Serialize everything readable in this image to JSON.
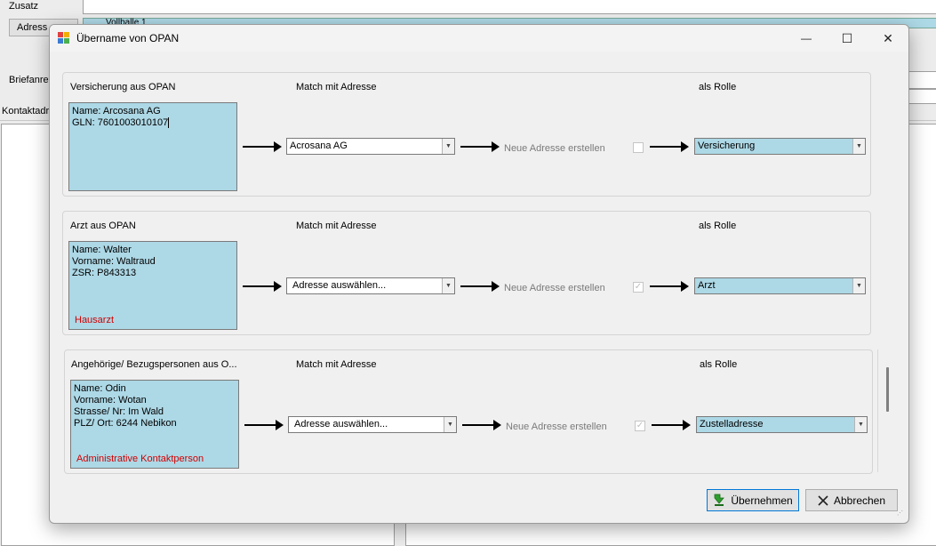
{
  "background": {
    "zusatz_label": "Zusatz",
    "adresse_button": "Adress",
    "tab_text": "Vollballe 1",
    "briefanrede_label": "Briefanrec",
    "kontaktadresse_label": "Kontaktadr"
  },
  "dialog": {
    "title": "Übername von OPAN",
    "minimize_symbol": "—",
    "maximize_symbol": "☐",
    "close_symbol": "✕",
    "ok_label": "Übernehmen",
    "cancel_label": "Abbrechen",
    "sections": [
      {
        "header": "Versicherung aus OPAN",
        "match_header": "Match mit Adresse",
        "role_header": "als Rolle",
        "info_lines": [
          "Name: Arcosana AG",
          "GLN: 7601003010107"
        ],
        "note": "",
        "match_value": "Acrosana AG",
        "new_address_label": "Neue Adresse erstellen",
        "new_address_checked": false,
        "role_value": "Versicherung"
      },
      {
        "header": "Arzt aus OPAN",
        "match_header": "Match mit Adresse",
        "role_header": "als Rolle",
        "info_lines": [
          "Name: Walter",
          "Vorname: Waltraud",
          "ZSR: P843313"
        ],
        "note": "Hausarzt",
        "match_value": "Adresse auswählen...",
        "new_address_label": "Neue Adresse erstellen",
        "new_address_checked": true,
        "role_value": "Arzt"
      },
      {
        "header": "Angehörige/ Bezugspersonen aus O...",
        "match_header": "Match mit Adresse",
        "role_header": "als Rolle",
        "info_lines": [
          "Name: Odin",
          "Vorname: Wotan",
          "Strasse/ Nr: Im Wald",
          "PLZ/ Ort: 6244 Nebikon"
        ],
        "note": "Administrative Kontaktperson",
        "match_value": "Adresse auswählen...",
        "new_address_label": "Neue Adresse erstellen",
        "new_address_checked": true,
        "role_value": "Zustelladresse"
      }
    ]
  },
  "colors": {
    "info_box": "#add8e6",
    "note_red": "#d00000",
    "accent": "#0078d7"
  }
}
